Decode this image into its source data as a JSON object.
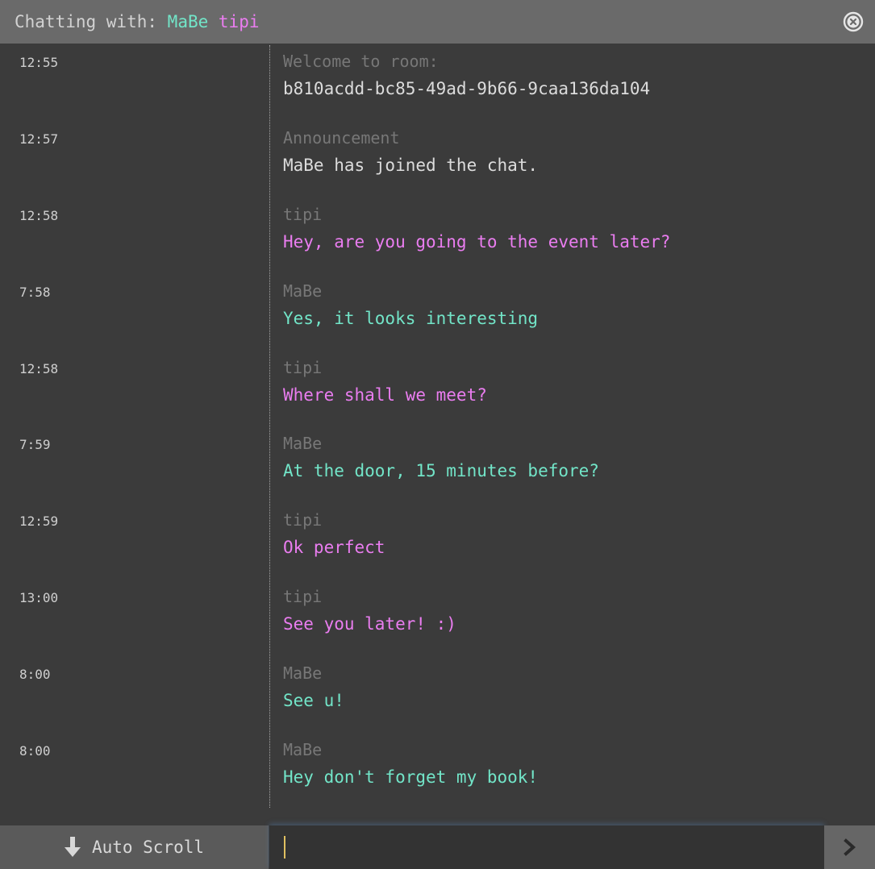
{
  "header": {
    "prefix": "Chatting with:",
    "user_a": "MaBe",
    "user_b": "tipi",
    "close_icon": "close-circle-icon"
  },
  "colors": {
    "user_a": "#72e5c8",
    "user_b": "#ea7df0",
    "sender_label": "#777777",
    "header_bg": "#6a6a6a",
    "body_bg": "#3b3b3b"
  },
  "messages": [
    {
      "time": "12:55",
      "sender": "Welcome to room:",
      "text": "b810acdd-bc85-49ad-9b66-9caa136da104"
    },
    {
      "time": "12:57",
      "sender": "Announcement",
      "text": "MaBe has joined the chat."
    },
    {
      "time": "12:58",
      "sender": "tipi",
      "text": "Hey, are you going to the event later?"
    },
    {
      "time": "7:58",
      "sender": "MaBe",
      "text": "Yes, it looks interesting"
    },
    {
      "time": "12:58",
      "sender": "tipi",
      "text": "Where shall we meet?"
    },
    {
      "time": "7:59",
      "sender": "MaBe",
      "text": "At the door, 15 minutes before?"
    },
    {
      "time": "12:59",
      "sender": "tipi",
      "text": "Ok perfect"
    },
    {
      "time": "13:00",
      "sender": "tipi",
      "text": "See you later! :)"
    },
    {
      "time": "8:00",
      "sender": "MaBe",
      "text": "See u!"
    },
    {
      "time": "8:00",
      "sender": "MaBe",
      "text": "Hey don't forget my book!"
    }
  ],
  "footer": {
    "autoscroll_label": "Auto Scroll",
    "autoscroll_icon": "arrow-down-icon",
    "input_value": "",
    "send_icon": "chevron-right-icon"
  }
}
